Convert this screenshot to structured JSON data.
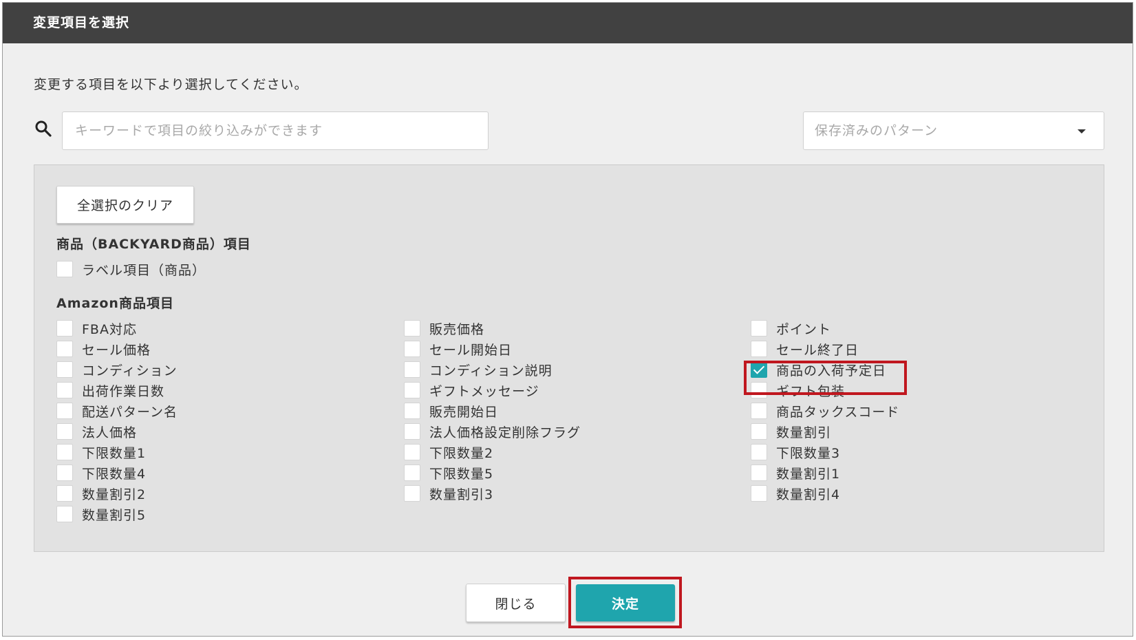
{
  "dialog": {
    "title": "変更項目を選択",
    "instruction": "変更する項目を以下より選択してください。"
  },
  "search": {
    "placeholder": "キーワードで項目の絞り込みができます",
    "icon": "search-icon"
  },
  "pattern_select": {
    "placeholder": "保存済みのパターン",
    "icon": "caret-down-icon"
  },
  "panel": {
    "clear_label": "全選択のクリア",
    "sections": [
      {
        "heading": "商品（BACKYARD商品）項目",
        "items": [
          {
            "label": "ラベル項目（商品）",
            "checked": false
          }
        ]
      },
      {
        "heading": "Amazon商品項目",
        "columns": [
          [
            {
              "label": "FBA対応",
              "checked": false
            },
            {
              "label": "セール価格",
              "checked": false
            },
            {
              "label": "コンディション",
              "checked": false
            },
            {
              "label": "出荷作業日数",
              "checked": false
            },
            {
              "label": "配送パターン名",
              "checked": false
            },
            {
              "label": "法人価格",
              "checked": false
            },
            {
              "label": "下限数量1",
              "checked": false
            },
            {
              "label": "下限数量4",
              "checked": false
            },
            {
              "label": "数量割引2",
              "checked": false
            },
            {
              "label": "数量割引5",
              "checked": false
            }
          ],
          [
            {
              "label": "販売価格",
              "checked": false
            },
            {
              "label": "セール開始日",
              "checked": false
            },
            {
              "label": "コンディション説明",
              "checked": false
            },
            {
              "label": "ギフトメッセージ",
              "checked": false
            },
            {
              "label": "販売開始日",
              "checked": false
            },
            {
              "label": "法人価格設定削除フラグ",
              "checked": false
            },
            {
              "label": "下限数量2",
              "checked": false
            },
            {
              "label": "下限数量5",
              "checked": false
            },
            {
              "label": "数量割引3",
              "checked": false
            }
          ],
          [
            {
              "label": "ポイント",
              "checked": false
            },
            {
              "label": "セール終了日",
              "checked": false
            },
            {
              "label": "商品の入荷予定日",
              "checked": true
            },
            {
              "label": "ギフト包装",
              "checked": false
            },
            {
              "label": "商品タックスコード",
              "checked": false
            },
            {
              "label": "数量割引",
              "checked": false
            },
            {
              "label": "下限数量3",
              "checked": false
            },
            {
              "label": "数量割引1",
              "checked": false
            },
            {
              "label": "数量割引4",
              "checked": false
            }
          ]
        ]
      }
    ]
  },
  "footer": {
    "close_label": "閉じる",
    "submit_label": "決定"
  },
  "colors": {
    "titlebar": "#414141",
    "accent": "#1fa5ad",
    "highlight": "#c0171f",
    "panel_bg": "#e2e2e2",
    "dialog_bg": "#efefef"
  }
}
